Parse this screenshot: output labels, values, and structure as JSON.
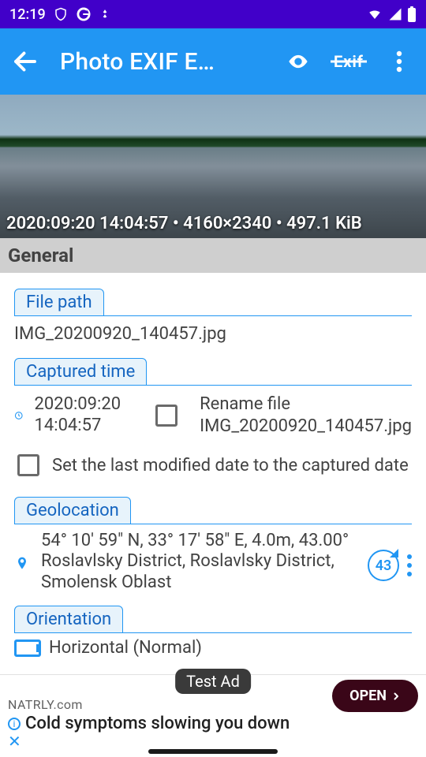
{
  "status": {
    "time": "12:19"
  },
  "appbar": {
    "title": "Photo EXIF E…"
  },
  "hero": {
    "meta": "2020:09:20 14:04:57 • 4160×2340 • 497.1 KiB"
  },
  "section_general": "General",
  "filepath": {
    "label": "File path",
    "value": "IMG_20200920_140457.jpg"
  },
  "captured": {
    "label": "Captured time",
    "date": "2020:09:20",
    "time": "14:04:57",
    "rename_label": "Rename file",
    "rename_value": "IMG_20200920_140457.jpg",
    "set_modified": "Set the last modified date to the captured date"
  },
  "geo": {
    "label": "Geolocation",
    "line1": "54° 10' 59\" N, 33° 17' 58\" E,  4.0m, 43.00°",
    "line2": "Roslavlsky District, Roslavlsky District, Smolensk Oblast",
    "badge": "43"
  },
  "orientation": {
    "label": "Orientation",
    "value": "Horizontal (Normal)"
  },
  "ad": {
    "tag": "Test Ad",
    "brand": "NATRLY.com",
    "headline": "Cold symptoms slowing you down",
    "cta": "OPEN"
  }
}
